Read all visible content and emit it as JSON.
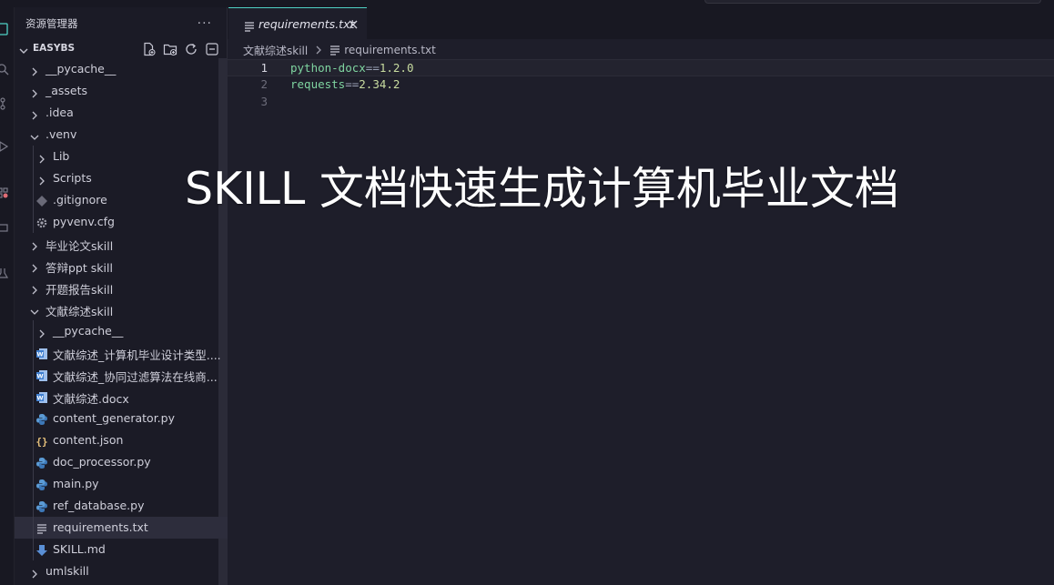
{
  "explorer": {
    "title": "资源管理器",
    "more": "···",
    "project": "EASYBS",
    "items": [
      {
        "label": "__pycache__",
        "kind": "folder",
        "expanded": false,
        "depth": 0
      },
      {
        "label": "_assets",
        "kind": "folder",
        "expanded": false,
        "depth": 0
      },
      {
        "label": ".idea",
        "kind": "folder",
        "expanded": false,
        "depth": 0
      },
      {
        "label": ".venv",
        "kind": "folder",
        "expanded": true,
        "depth": 0
      },
      {
        "label": "Lib",
        "kind": "folder",
        "expanded": false,
        "depth": 1
      },
      {
        "label": "Scripts",
        "kind": "folder",
        "expanded": false,
        "depth": 1
      },
      {
        "label": ".gitignore",
        "kind": "git",
        "depth": 1
      },
      {
        "label": "pyvenv.cfg",
        "kind": "gear",
        "depth": 1
      },
      {
        "label": "毕业论文skill",
        "kind": "folder",
        "expanded": false,
        "depth": 0
      },
      {
        "label": "答辩ppt skill",
        "kind": "folder",
        "expanded": false,
        "depth": 0
      },
      {
        "label": "开题报告skill",
        "kind": "folder",
        "expanded": false,
        "depth": 0
      },
      {
        "label": "文献综述skill",
        "kind": "folder",
        "expanded": true,
        "depth": 0
      },
      {
        "label": "__pycache__",
        "kind": "folder",
        "expanded": false,
        "depth": 1
      },
      {
        "label": "文献综述_计算机毕业设计类型....",
        "kind": "word",
        "depth": 1
      },
      {
        "label": "文献综述_协同过滤算法在线商...",
        "kind": "word",
        "depth": 1
      },
      {
        "label": "文献综述.docx",
        "kind": "word",
        "depth": 1
      },
      {
        "label": "content_generator.py",
        "kind": "python",
        "depth": 1
      },
      {
        "label": "content.json",
        "kind": "json",
        "depth": 1
      },
      {
        "label": "doc_processor.py",
        "kind": "python",
        "depth": 1
      },
      {
        "label": "main.py",
        "kind": "python",
        "depth": 1
      },
      {
        "label": "ref_database.py",
        "kind": "python",
        "depth": 1
      },
      {
        "label": "requirements.txt",
        "kind": "text",
        "depth": 1,
        "selected": true
      },
      {
        "label": "SKILL.md",
        "kind": "markdown",
        "depth": 1
      },
      {
        "label": "umlskill",
        "kind": "folder",
        "expanded": false,
        "depth": 0
      }
    ]
  },
  "editor": {
    "tab_label": "requirements.txt",
    "breadcrumb": [
      "文献综述skill",
      "requirements.txt"
    ],
    "lines": [
      {
        "number": "1",
        "name": "python-docx",
        "op": "==",
        "ver": "1.2.0"
      },
      {
        "number": "2",
        "name": "requests",
        "op": "==",
        "ver": "2.34.2"
      },
      {
        "number": "3",
        "name": "",
        "op": "",
        "ver": ""
      }
    ]
  },
  "overlay_text": "SKILL 文档快速生成计算机毕业文档",
  "colors": {
    "accent": "#4fd1c5",
    "python": "#5b9bd5",
    "word": "#3f7fd0",
    "json": "#e5c07b",
    "markdown": "#5a8fd6"
  }
}
